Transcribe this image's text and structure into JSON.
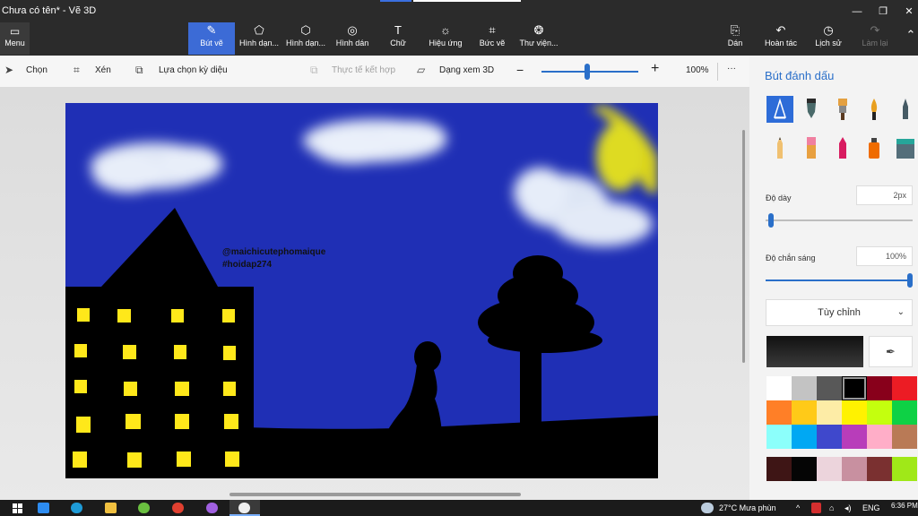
{
  "window": {
    "title": "Chưa có tên* - Vẽ 3D",
    "controls": [
      "—",
      "❐",
      "✕"
    ]
  },
  "ribbon": {
    "menu_label": "Menu",
    "tools": [
      {
        "label": "Bút vẽ",
        "icon": "brush-icon",
        "glyph": "✎"
      },
      {
        "label": "Hình dạn...",
        "icon": "2d-shapes-icon",
        "glyph": "⬠"
      },
      {
        "label": "Hình dạn...",
        "icon": "3d-shapes-icon",
        "glyph": "⬡"
      },
      {
        "label": "Hình dán",
        "icon": "stickers-icon",
        "glyph": "◎"
      },
      {
        "label": "Chữ",
        "icon": "text-icon",
        "glyph": "T"
      },
      {
        "label": "Hiệu ứng",
        "icon": "effects-icon",
        "glyph": "☼"
      },
      {
        "label": "Bức vẽ",
        "icon": "canvas-icon",
        "glyph": "⌗"
      },
      {
        "label": "Thư viện...",
        "icon": "3d-library-icon",
        "glyph": "❂"
      }
    ],
    "right_tools": [
      {
        "label": "Dán",
        "icon": "paste-icon",
        "glyph": "📋"
      },
      {
        "label": "Hoàn tác",
        "icon": "undo-icon",
        "glyph": "↶"
      },
      {
        "label": "Lịch sử",
        "icon": "history-icon",
        "glyph": "◷"
      },
      {
        "label": "Làm lại",
        "icon": "redo-icon",
        "glyph": "↷"
      }
    ]
  },
  "toolrow": {
    "select": "Chọn",
    "crop": "Xén",
    "magic_select": "Lựa chọn kỳ diệu",
    "mixed_reality": "Thực tế kết hợp",
    "view_3d": "Dạng xem 3D",
    "zoom_minus": "−",
    "zoom_plus": "+",
    "zoom_value": "100%",
    "more": "···",
    "zoom_level": 0.47
  },
  "canvas": {
    "watermark_line1": "@maichicutephomaique",
    "watermark_line2": "#hoidap274"
  },
  "panel": {
    "title": "Bút đánh dấu",
    "brushes": [
      "marker",
      "calligraphy-pen",
      "oil-brush",
      "watercolor",
      "pixel-pen",
      "pencil",
      "eraser",
      "crayon",
      "spray-can",
      "fill-bucket"
    ],
    "thickness_label": "Độ dày",
    "thickness_value": "2px",
    "thickness_level": 0.02,
    "opacity_label": "Độ chắn sáng",
    "opacity_value": "100%",
    "opacity_level": 1.0,
    "finish_label": "Tùy chỉnh",
    "eyedropper_icon": "eyedropper-icon",
    "palette": [
      "#ffffff",
      "#c3c3c3",
      "#585858",
      "#000000",
      "#88001b",
      "#ec1c24",
      "#ff7f27",
      "#ffca18",
      "#fdeca6",
      "#fff200",
      "#c4ff0e",
      "#0ed145",
      "#8cfffb",
      "#00a8f3",
      "#3f48cc",
      "#b83dba",
      "#ffaec8",
      "#b97a56",
      "#3e1515",
      "#050505",
      "#ecd4dc",
      "#c890a0",
      "#7a3030",
      "#a0e818"
    ]
  },
  "taskbar": {
    "weather": "27°C  Mưa phùn",
    "lang": "ENG",
    "time": "6:36 PM"
  }
}
